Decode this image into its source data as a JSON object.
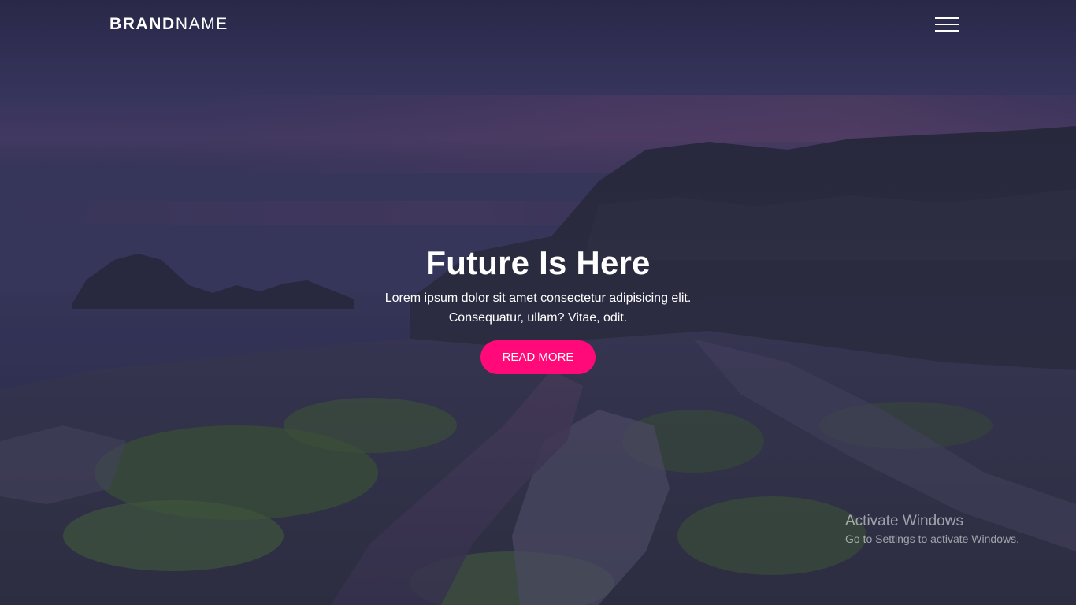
{
  "navbar": {
    "brand_bold": "BRAND",
    "brand_light": "NAME",
    "menu_icon": "hamburger-menu-icon"
  },
  "hero": {
    "title": "Future Is Here",
    "text_line1": "Lorem ipsum dolor sit amet consectetur adipisicing elit.",
    "text_line2": "Consequatur, ullam? Vitae, odit.",
    "button_label": "READ MORE",
    "button_color": "#ff0a78",
    "background_image": "coastal-rocks-sunset"
  },
  "watermark": {
    "title": "Activate Windows",
    "subtitle": "Go to Settings to activate Windows."
  }
}
